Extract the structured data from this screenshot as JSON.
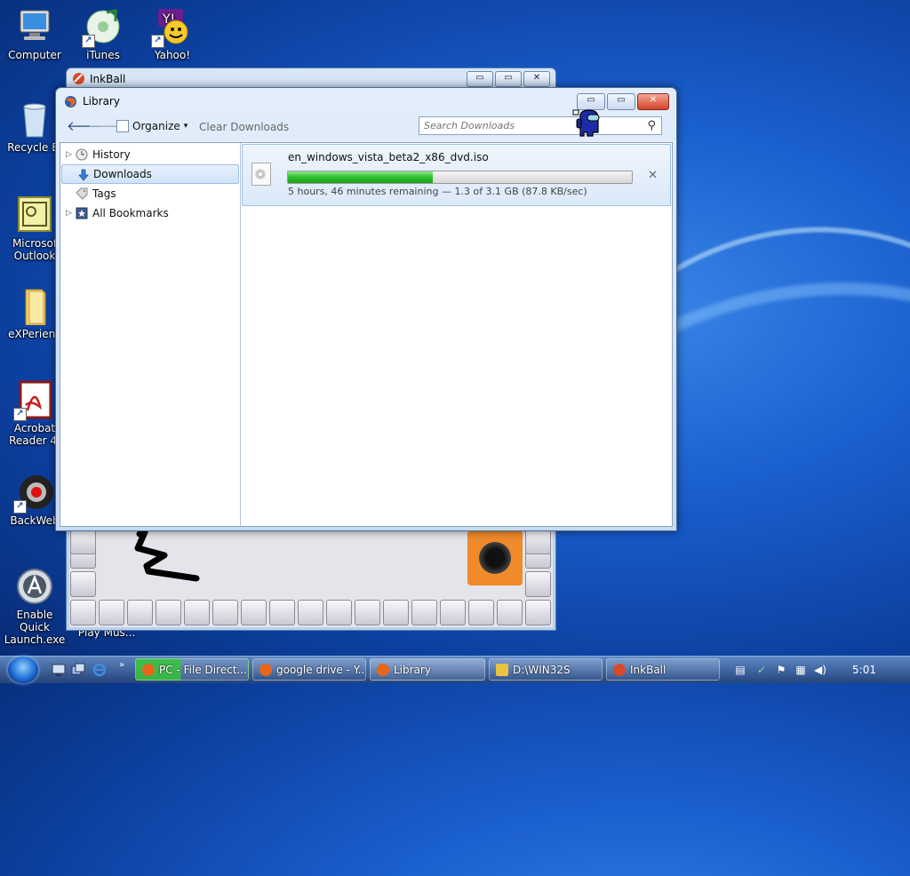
{
  "desktop": {
    "icons": [
      {
        "label": "Computer"
      },
      {
        "label": "iTunes"
      },
      {
        "label": "Yahoo!"
      },
      {
        "label": "Recycle Bi"
      },
      {
        "label": "Microsof\nOutlook"
      },
      {
        "label": "eXPerienc"
      },
      {
        "label": "Acrobat\nReader 4."
      },
      {
        "label": "BackWeb"
      },
      {
        "label": "Enable Quick\nLaunch.exe"
      }
    ],
    "stray_label": "Play Mus..."
  },
  "inkball": {
    "title": "InkBall",
    "min_label": "▭",
    "max_label": "▭",
    "close_label": "✕"
  },
  "library": {
    "title": "Library",
    "min_label": "▭",
    "max_label": "▭",
    "close_label": "✕",
    "toolbar": {
      "back_label": "🡐",
      "forward_label": "🡒",
      "organize_label": "Organize",
      "organize_arrow": "▾",
      "clear_label": "Clear Downloads",
      "search_placeholder": "Search Downloads"
    },
    "sidebar": [
      {
        "label": "History",
        "expandable": true
      },
      {
        "label": "Downloads",
        "selected": true
      },
      {
        "label": "Tags"
      },
      {
        "label": "All Bookmarks",
        "expandable": true
      }
    ],
    "download": {
      "filename": "en_windows_vista_beta2_x86_dvd.iso",
      "progress": 0.42,
      "status": "5 hours, 46 minutes remaining — 1.3 of 3.1 GB (87.8 KB/sec)",
      "cancel_label": "✕"
    }
  },
  "taskbar": {
    "tasks": [
      {
        "label": "PC - File Direct...",
        "icon_color": "#e8661c"
      },
      {
        "label": "google drive - Y...",
        "icon_color": "#e8661c"
      },
      {
        "label": "Library",
        "icon_color": "#e8661c"
      },
      {
        "label": "D:\\WIN32S",
        "icon_color": "#e8c440"
      },
      {
        "label": "InkBall",
        "icon_color": "#d94a2a"
      }
    ],
    "clock": "5:01"
  },
  "colors": {
    "accent": "#2dbd2d",
    "selection": "#cfe2f8"
  }
}
